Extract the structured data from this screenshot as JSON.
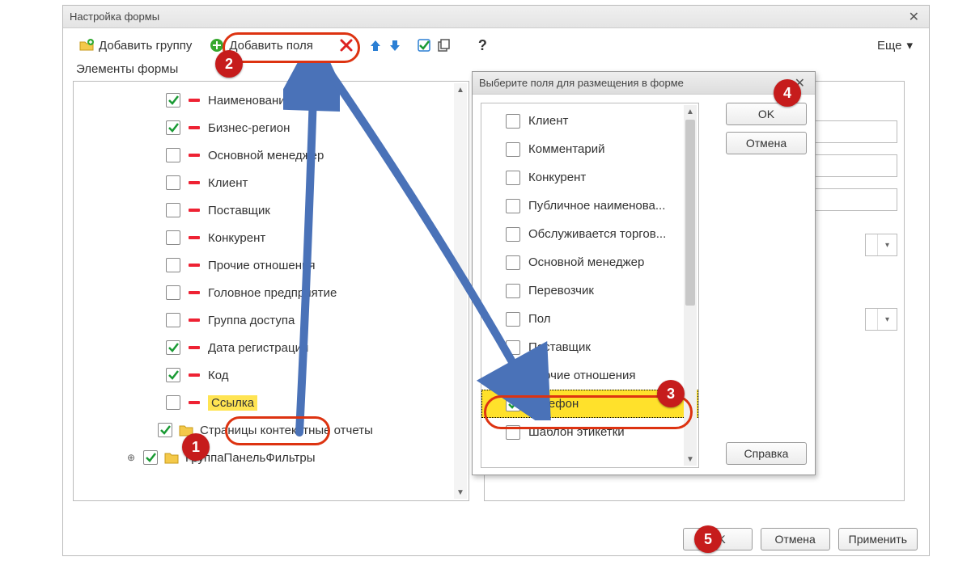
{
  "dialog": {
    "title": "Настройка формы",
    "toolbar": {
      "add_group": "Добавить группу",
      "add_fields": "Добавить поля",
      "more": "Еще",
      "help": "?"
    },
    "elements_label": "Элементы формы",
    "tree": [
      {
        "checked": true,
        "label": "Наименование"
      },
      {
        "checked": true,
        "label": "Бизнес-регион"
      },
      {
        "checked": false,
        "label": "Основной менеджер"
      },
      {
        "checked": false,
        "label": "Клиент"
      },
      {
        "checked": false,
        "label": "Поставщик"
      },
      {
        "checked": false,
        "label": "Конкурент"
      },
      {
        "checked": false,
        "label": "Прочие отношения"
      },
      {
        "checked": false,
        "label": "Головное предприятие"
      },
      {
        "checked": false,
        "label": "Группа доступа"
      },
      {
        "checked": true,
        "label": "Дата регистрации"
      },
      {
        "checked": true,
        "label": "Код"
      },
      {
        "checked": false,
        "label": "Ссылка",
        "highlight": true
      }
    ],
    "folders": [
      {
        "checked": true,
        "label": "Страницы контекстные отчеты"
      },
      {
        "checked": true,
        "label": "ГруппаПанельФильтры",
        "expandable": true
      }
    ],
    "footer": {
      "ok": "OK",
      "cancel": "Отмена",
      "apply": "Применить"
    }
  },
  "popup": {
    "title": "Выберите поля для размещения в форме",
    "items": [
      {
        "checked": false,
        "label": "Клиент"
      },
      {
        "checked": false,
        "label": "Комментарий"
      },
      {
        "checked": false,
        "label": "Конкурент"
      },
      {
        "checked": false,
        "label": "Публичное наименова..."
      },
      {
        "checked": false,
        "label": "Обслуживается торгов..."
      },
      {
        "checked": false,
        "label": "Основной менеджер"
      },
      {
        "checked": false,
        "label": "Перевозчик"
      },
      {
        "checked": false,
        "label": "Пол"
      },
      {
        "checked": false,
        "label": "Поставщик"
      },
      {
        "checked": false,
        "label": "Прочие отношения"
      },
      {
        "checked": true,
        "label": "Телефон",
        "selected": true
      },
      {
        "checked": false,
        "label": "Шаблон этикетки"
      }
    ],
    "buttons": {
      "ok": "OK",
      "cancel": "Отмена",
      "help": "Справка"
    }
  },
  "annotations": {
    "n1": "1",
    "n2": "2",
    "n3": "3",
    "n4": "4",
    "n5": "5"
  }
}
